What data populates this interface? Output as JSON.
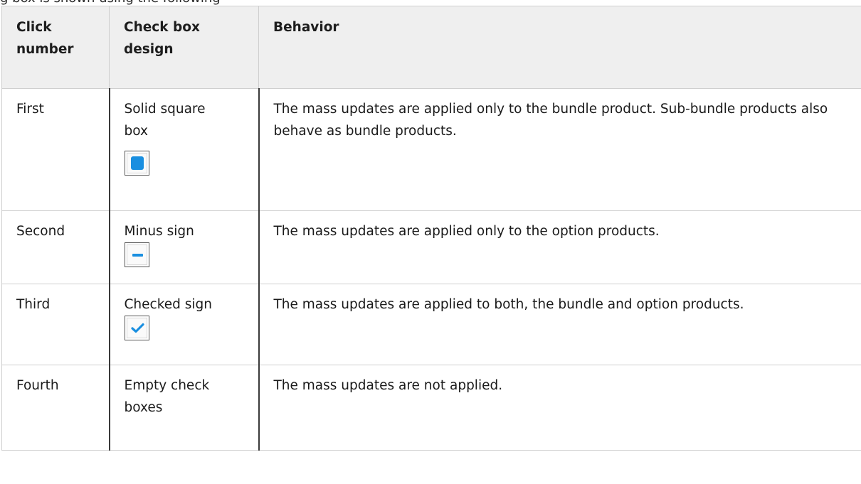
{
  "top_fragment": "g box is shown using the following",
  "colors": {
    "header_bg": "#efefef",
    "border": "#cfcfcf",
    "icon_blue": "#1a8fe0"
  },
  "table": {
    "headers": [
      "Click number",
      "Check box design",
      "Behavior"
    ],
    "rows": [
      {
        "click": "First",
        "design": "Solid square box",
        "icon": "solid-square-checkbox-icon",
        "behavior": "The mass updates are applied only to the bundle product. Sub-bundle products also behave as bundle products."
      },
      {
        "click": "Second",
        "design": "Minus sign",
        "icon": "minus-checkbox-icon",
        "behavior": "The mass updates are applied only to the option products."
      },
      {
        "click": "Third",
        "design": "Checked sign",
        "icon": "checked-checkbox-icon",
        "behavior": "The mass updates are applied to both, the bundle and option products."
      },
      {
        "click": "Fourth",
        "design": "Empty check boxes",
        "icon": "",
        "behavior": "The mass updates are not applied."
      }
    ]
  }
}
